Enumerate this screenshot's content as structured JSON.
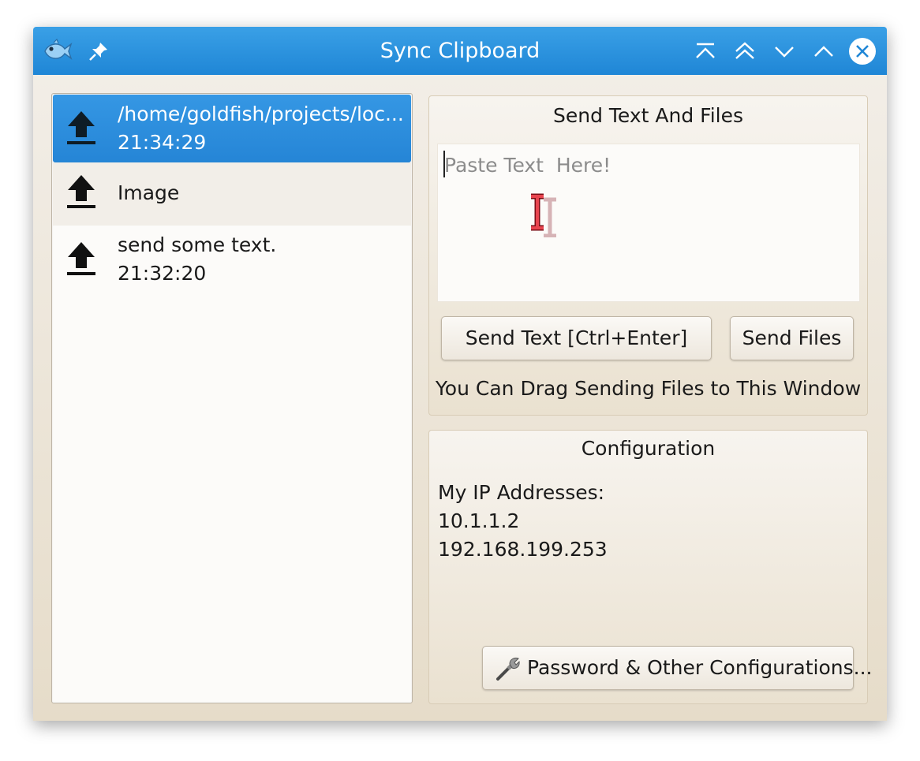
{
  "window": {
    "title": "Sync Clipboard",
    "icons": {
      "app": "goldfish-icon",
      "pin": "pin-icon",
      "keep_above": "keep-above-icon",
      "shade": "shade-icon",
      "minimize": "minimize-icon",
      "maximize": "maximize-icon",
      "close": "close-icon"
    }
  },
  "history": {
    "items": [
      {
        "icon": "upload-icon",
        "title": "/home/goldfish/projects/loc...",
        "time": "21:34:29",
        "state": "selected"
      },
      {
        "icon": "upload-icon",
        "title": "Image",
        "time": "",
        "state": "hover"
      },
      {
        "icon": "upload-icon",
        "title": "send some text.",
        "time": "21:32:20",
        "state": "normal"
      }
    ]
  },
  "send": {
    "title": "Send Text And Files",
    "placeholder": "Paste Text  Here!",
    "value": "",
    "send_text_label": "Send Text [Ctrl+Enter]",
    "send_files_label": "Send Files",
    "drag_hint": "You Can Drag Sending Files to This Window"
  },
  "config": {
    "title": "Configuration",
    "ip_heading": "My IP Addresses:",
    "ips": [
      "10.1.1.2",
      "192.168.199.253"
    ],
    "settings_label": "Password & Other Configurations...",
    "settings_icon": "wrench-icon"
  },
  "colors": {
    "titlebar": "#2590dd",
    "selection": "#2d8fe0",
    "close_circle": "#ffffff"
  }
}
